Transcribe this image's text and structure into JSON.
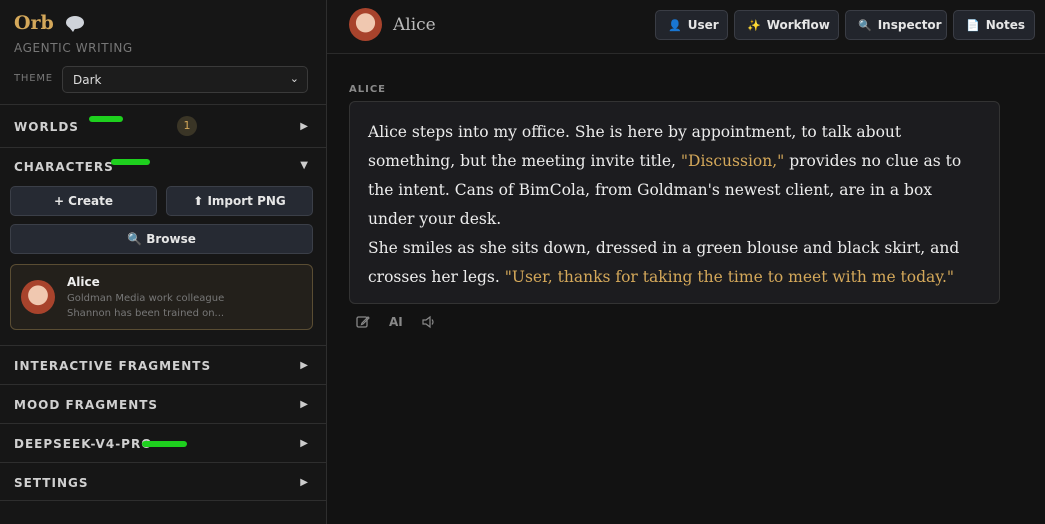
{
  "brand": {
    "title": "Orb",
    "subtitle": "AGENTIC WRITING",
    "chat_icon": "speech-bubble-icon"
  },
  "theme": {
    "label": "THEME",
    "value": "Dark"
  },
  "sections": {
    "worlds": {
      "label": "WORLDS",
      "badge": "1"
    },
    "characters": {
      "label": "CHARACTERS"
    },
    "interactive": {
      "label": "INTERACTIVE FRAGMENTS"
    },
    "mood": {
      "label": "MOOD FRAGMENTS"
    },
    "model": {
      "label": "DEEPSEEK-V4-PRO"
    },
    "settings": {
      "label": "SETTINGS"
    }
  },
  "characters": {
    "create_label": "+ Create",
    "import_label": "⬆ Import PNG",
    "browse_label": "Browse",
    "card": {
      "name": "Alice",
      "line1": "Goldman Media work colleague",
      "line2": "Shannon has been trained on..."
    }
  },
  "header": {
    "title": "Alice"
  },
  "toolbar": {
    "user": "User",
    "workflow": "Workflow",
    "inspector": "Inspector",
    "notes": "Notes"
  },
  "message": {
    "author": "ALICE",
    "p1_a": "Alice steps into my office. She is here by appointment, to talk about something, but the meeting invite title, ",
    "p1_q": "\"Discussion,\"",
    "p1_b": " provides no clue as to the intent. Cans of BimCola, from Goldman's newest client, are in a box under your desk.",
    "p2_a": "She smiles as she sits down, dressed in a green blouse and black skirt, and crosses her legs. ",
    "p2_q": "\"User, thanks for taking the time to meet with me today.\"",
    "ai_label": "AI"
  },
  "colors": {
    "accent": "#d4a85a",
    "highlight_marker": "#1ed01e",
    "background": "#121212"
  }
}
